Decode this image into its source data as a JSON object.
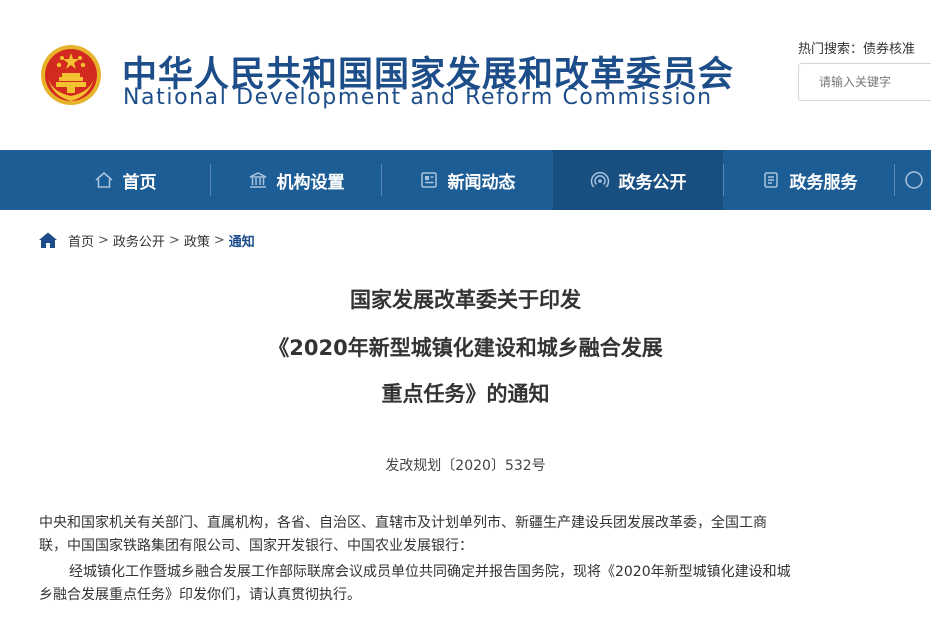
{
  "header": {
    "title_cn": "中华人民共和国国家发展和改革委员会",
    "title_en": "National Development and Reform Commission",
    "hot_search_label": "热门搜索：",
    "hot_search_keyword": "债券核准",
    "search_placeholder": "请输入关键字"
  },
  "nav": {
    "items": [
      {
        "label": "首页"
      },
      {
        "label": "机构设置"
      },
      {
        "label": "新闻动态"
      },
      {
        "label": "政务公开"
      },
      {
        "label": "政务服务"
      }
    ]
  },
  "breadcrumb": {
    "items": [
      "首页",
      "政务公开",
      "政策",
      "通知"
    ],
    "separator": ">"
  },
  "article": {
    "title_lines": [
      "国家发展改革委关于印发",
      "《2020年新型城镇化建设和城乡融合发展",
      "重点任务》的通知"
    ],
    "doc_number": "发改规划〔2020〕532号",
    "recipients_line1": "中央和国家机关有关部门、直属机构，各省、自治区、直辖市及计划单列市、新疆生产建设兵团发展改革委，全国工商",
    "recipients_line2": "联，中国国家铁路集团有限公司、国家开发银行、中国农业发展银行：",
    "body_line1": "经城镇化工作暨城乡融合发展工作部际联席会议成员单位共同确定并报告国务院，现将《2020年新型城镇化建设和城",
    "body_line2": "乡融合发展重点任务》印发你们，请认真贯彻执行。"
  },
  "colors": {
    "brand_blue": "#1d4e8a",
    "nav_bg": "#1d5d96",
    "nav_active_bg": "#184f80",
    "emblem_red": "#d22a1f",
    "emblem_gold": "#f2c230"
  },
  "icons": {
    "nav": [
      "home-icon",
      "institution-icon",
      "news-icon",
      "broadcast-icon",
      "service-icon"
    ],
    "breadcrumb": "home-icon"
  }
}
